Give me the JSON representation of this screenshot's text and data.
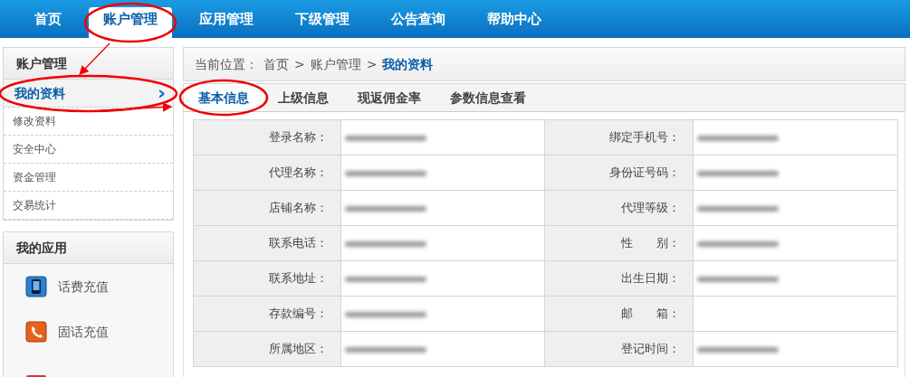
{
  "nav": [
    {
      "label": "首页",
      "selected": false,
      "circled": false
    },
    {
      "label": "账户管理",
      "selected": true,
      "circled": true
    },
    {
      "label": "应用管理",
      "selected": false,
      "circled": false
    },
    {
      "label": "下级管理",
      "selected": false,
      "circled": false
    },
    {
      "label": "公告查询",
      "selected": false,
      "circled": false
    },
    {
      "label": "帮助中心",
      "selected": false,
      "circled": false
    }
  ],
  "sidebar": {
    "title": "账户管理",
    "items": [
      {
        "label": "我的资料",
        "selected": true,
        "circled": true,
        "chevron": "›"
      },
      {
        "label": "修改资料",
        "selected": false,
        "circled": false
      },
      {
        "label": "安全中心",
        "selected": false,
        "circled": false
      },
      {
        "label": "资金管理",
        "selected": false,
        "circled": false
      },
      {
        "label": "交易统计",
        "selected": false,
        "circled": false
      }
    ]
  },
  "apps": {
    "title": "我的应用",
    "items": [
      {
        "label": "话费充值",
        "kind": "phone"
      },
      {
        "label": "固话充值",
        "kind": "landline"
      },
      {
        "kind": "red"
      }
    ]
  },
  "breadcrumb": {
    "prefix": "当前位置：",
    "parts": [
      "首页",
      "账户管理"
    ],
    "separator": ">",
    "current": "我的资料"
  },
  "tabs": [
    {
      "label": "基本信息",
      "selected": true,
      "circled": true
    },
    {
      "label": "上级信息",
      "selected": false,
      "circled": false
    },
    {
      "label": "现返佣金率",
      "selected": false,
      "circled": false
    },
    {
      "label": "参数信息查看",
      "selected": false,
      "circled": false
    }
  ],
  "rows": [
    [
      {
        "label": "登录名称：",
        "kind": "blurred"
      },
      {
        "label": "绑定手机号：",
        "kind": "blurred"
      }
    ],
    [
      {
        "label": "代理名称：",
        "kind": "blurred"
      },
      {
        "label": "身份证号码：",
        "kind": "blurred"
      }
    ],
    [
      {
        "label": "店铺名称：",
        "kind": "blurred"
      },
      {
        "label": "代理等级：",
        "kind": "blurred"
      }
    ],
    [
      {
        "label": "联系电话：",
        "kind": "blurred"
      },
      {
        "label": "性　　别：",
        "kind": "blurred"
      }
    ],
    [
      {
        "label": "联系地址：",
        "kind": "blurred"
      },
      {
        "label": "出生日期：",
        "kind": "blurred"
      }
    ],
    [
      {
        "label": "存款编号：",
        "kind": "blurred"
      },
      {
        "label": "邮　　箱：",
        "kind": "empty"
      }
    ],
    [
      {
        "label": "所属地区：",
        "kind": "blurred"
      },
      {
        "label": "登记时间：",
        "kind": "blurred"
      }
    ]
  ]
}
